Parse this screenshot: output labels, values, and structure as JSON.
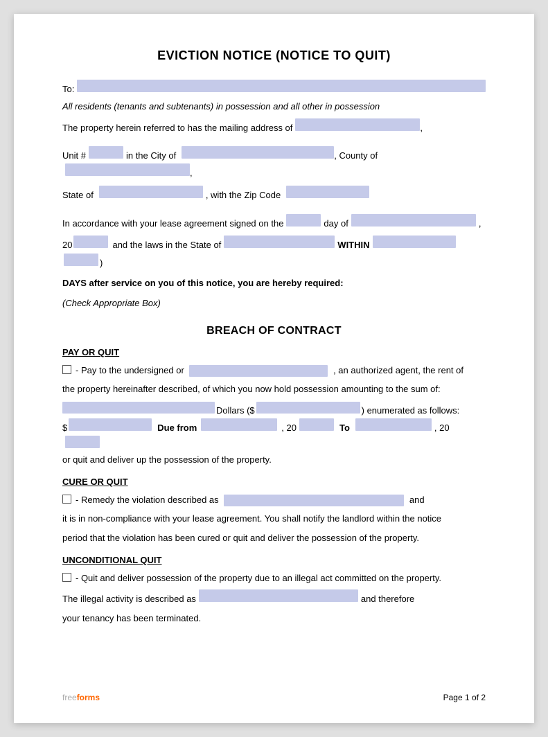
{
  "document": {
    "title": "EVICTION NOTICE (NOTICE TO QUIT)",
    "to_label": "To:",
    "residents_note": "All residents (tenants and subtenants) in possession and all other in possession",
    "address_prefix": "The property herein referred to has the mailing address of",
    "unit_label": "Unit #",
    "city_label": "in the City of",
    "county_label": ", County of",
    "state_label": "State of",
    "zip_label": ", with the Zip Code",
    "lease_intro": "In accordance with your lease agreement signed on the",
    "day_label": "day of",
    "year_prefix": "20",
    "state_laws": "and the laws in the State of",
    "within_label": "WITHIN",
    "days_text": "DAYS after service on you of this notice, you are hereby required:",
    "check_box_note": "(Check Appropriate Box)",
    "breach_title": "BREACH OF CONTRACT",
    "pay_or_quit_title": "PAY OR QUIT",
    "pay_or_quit_text1": "- Pay to the undersigned or",
    "pay_or_quit_text2": ", an authorized agent, the rent of",
    "pay_or_quit_text3": "the property hereinafter described, of which you now hold possession amounting to the sum of:",
    "dollars_label": "Dollars ($",
    "enumerated_label": ") enumerated as follows:",
    "due_from_label": "Due from",
    "comma_20": ", 20",
    "to_label2": "To",
    "comma_20b": ", 20",
    "or_quit_text": "or quit and deliver up the possession of the property.",
    "cure_or_quit_title": "CURE OR QUIT",
    "cure_text1": "- Remedy the violation described as",
    "cure_text2": "and",
    "cure_text3": "it is in non-compliance with your lease agreement. You shall notify the landlord within the notice",
    "cure_text4": "period that the violation has been cured or quit and deliver the possession of the property.",
    "unconditional_quit_title": "UNCONDITIONAL QUIT",
    "unconditional_text": "- Quit and deliver possession of the property due to an illegal act committed on the property.",
    "illegal_prefix": "The illegal activity is described as",
    "illegal_suffix": "and therefore",
    "tenancy_terminated": "your tenancy has been terminated.",
    "footer_brand_free": "free",
    "footer_brand_forms": "forms",
    "page_label": "Page 1 of 2",
    "dollar_sign": "$",
    "dollars_field_prefix": "$"
  }
}
